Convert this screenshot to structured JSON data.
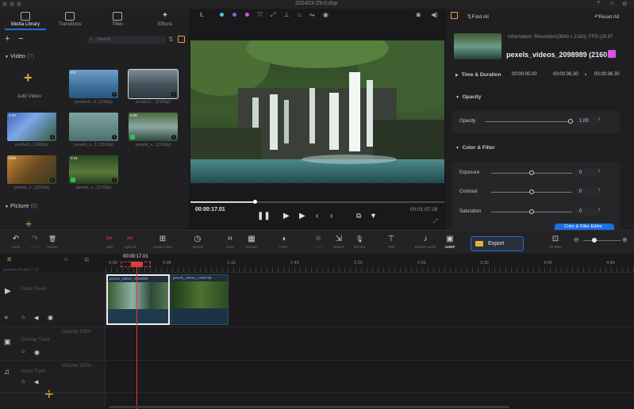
{
  "window": {
    "title": "202403-Z9-0.dvp"
  },
  "left_panel": {
    "tabs": [
      {
        "label": "Media Library",
        "active": true
      },
      {
        "label": "Transitions"
      },
      {
        "label": "Titles"
      },
      {
        "label": "Effects"
      }
    ],
    "search_placeholder": "Search",
    "video_section": {
      "title": "Video",
      "count": "(7)"
    },
    "add_video_label": "Add Video",
    "video_items": [
      {
        "duration": "0:0",
        "label": "producti...0 (2160p)"
      },
      {
        "duration": "",
        "label": "product... (2160p)"
      },
      {
        "duration": "0:30",
        "label": "product...(1080p)"
      },
      {
        "duration": "",
        "label": "pexels_v...1 (2160p)"
      },
      {
        "duration": "0:36",
        "label": "pexels_v...(2160p)"
      },
      {
        "duration": "0:09",
        "label": "pexels_v...(2160p)"
      },
      {
        "duration": "0:31",
        "label": "pexels_v...(2160p)"
      }
    ],
    "picture_section": {
      "title": "Picture",
      "count": "(0)"
    }
  },
  "preview": {
    "current_time": "00:00:17.01",
    "total_time": "00:01:07.29",
    "progress": 0.25
  },
  "right_panel": {
    "fold_all": "Fold All",
    "reset_all": "Reset All",
    "info": "Information: Resolution(3840 x 2160), FPS (29.97",
    "clip_name": "pexels_videos_2098989 (2160",
    "time_duration": {
      "label": "Time & Duration",
      "start": "00:00:00.00",
      "end": "00:00:36.30",
      "duration": "00:00:36.30"
    },
    "opacity": {
      "section": "Opacity",
      "label": "Opacity",
      "value": "1.00"
    },
    "color_filter": {
      "section": "Color & Filter",
      "rows": [
        {
          "label": "Exposure",
          "value": "0"
        },
        {
          "label": "Contrast",
          "value": "0"
        },
        {
          "label": "Saturation",
          "value": "0"
        }
      ],
      "editor_button": "Color & Filter Editor"
    }
  },
  "toolbar": {
    "items": [
      {
        "label": "Undo",
        "glyph": "↶"
      },
      {
        "label": "Redo",
        "glyph": "↷"
      },
      {
        "label": "Delete",
        "glyph": "🗑"
      },
      {
        "label": "Split",
        "glyph": "✂"
      },
      {
        "label": "Split All",
        "glyph": "✂"
      },
      {
        "label": "Aspect ratio",
        "glyph": "⊞"
      },
      {
        "label": "Speed",
        "glyph": "◷"
      },
      {
        "label": "Crop",
        "glyph": "⌗"
      },
      {
        "label": "Mosaic",
        "glyph": "▦"
      },
      {
        "label": "Color",
        "glyph": "◑"
      },
      {
        "label": "Freeze",
        "glyph": "❄"
      },
      {
        "label": "Detach",
        "glyph": "⇲"
      },
      {
        "label": "Record",
        "glyph": "🎙"
      },
      {
        "label": "Text",
        "glyph": "⊤"
      },
      {
        "label": "Extract Audio",
        "glyph": "♪"
      },
      {
        "label": "1080P",
        "glyph": "▣"
      },
      {
        "label": "Fit Best",
        "glyph": "⊡"
      }
    ],
    "export_label": "Export"
  },
  "timeline": {
    "playhead_time": "00:00:17.01",
    "position_label": "position:00:00:17.01",
    "ruler": [
      "0:00",
      "0:36",
      "1:10",
      "1:45",
      "2:20",
      "2:55",
      "3:30",
      "4:05",
      "4:40"
    ],
    "tracks": [
      {
        "name": "Video Track",
        "value": ""
      },
      {
        "name": "Overlay Track",
        "value": "Opacity 100%"
      },
      {
        "name": "Audio Track",
        "value": "Volume 100%"
      }
    ],
    "clips": [
      {
        "name": "pexels_videos_2098989"
      },
      {
        "name": "pexels_videos_1448735"
      }
    ]
  }
}
